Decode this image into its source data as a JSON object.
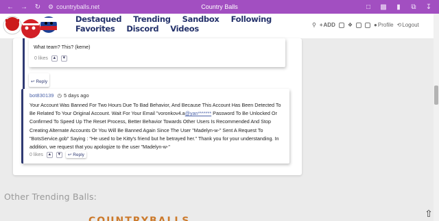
{
  "browser": {
    "url": "countryballs.net",
    "title": "Country Balls"
  },
  "nav": {
    "links": [
      "Destaqued",
      "Trending",
      "Sandbox",
      "Following",
      "Favorites",
      "Discord",
      "Videos"
    ]
  },
  "tools": {
    "add_label": "ADD",
    "profile_label": "Profile",
    "logout_label": "Logout"
  },
  "comments": {
    "first": {
      "text": "What team? This? (keme)",
      "likes": "0 likes",
      "reply_label": "Reply"
    },
    "second": {
      "author": "bot830139",
      "time": "5 days ago",
      "text_before": "Your Account Was Banned For Two Hours Due To Bad Behavior, And Because This Account Has Been Detected To Be Related To Your Original Account. Wait For Your Email \"voronkov4.a",
      "mention": "@yan*******",
      "text_after": " Password To Be Unlocked Or Confirmed To Speed Up The Reset Process, Better Behavior Towards Other Users Is Recommended And Stop Creating Alternate Accounts Or You Will Be Banned Again Since The User \"Madelyn-w-\" Sent A Request To \"BotsService.gob\" Saying : \"He used to be Kitty's friend but he betrayed her.\" Thank you for your understanding. In addition, we request that you apologize to the user \"Madelyn-w-\"",
      "likes": "0 likes",
      "reply_label": "Reply"
    }
  },
  "section": {
    "title": "Other Trending Balls:",
    "banner": "COUNTRYBALLS"
  },
  "colors": {
    "chrome": "#a24fc1",
    "nav_link": "#24326b",
    "thread": "#2f3a73",
    "author": "#4a61a8"
  }
}
